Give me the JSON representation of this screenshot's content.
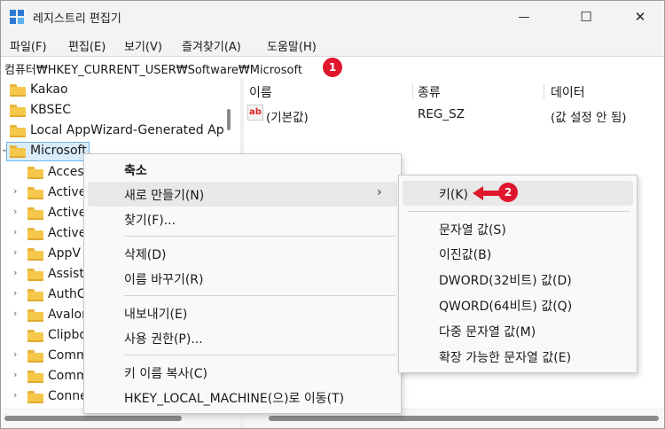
{
  "window": {
    "title": "레지스트리 편집기",
    "minimize_glyph": "—",
    "maximize_glyph": "☐",
    "close_glyph": "✕"
  },
  "menu": [
    "파일(F)",
    "편집(E)",
    "보기(V)",
    "즐겨찾기(A)",
    "도움말(H)"
  ],
  "address": {
    "path": "컴퓨터₩HKEY_CURRENT_USER₩Software₩Microsoft",
    "marker": "1"
  },
  "tree": {
    "items": [
      {
        "label": "Kakao"
      },
      {
        "label": "KBSEC"
      },
      {
        "label": "Local AppWizard-Generated Ap"
      },
      {
        "label": "Microsoft",
        "selected": true
      },
      {
        "label": "Acces"
      },
      {
        "label": "Active"
      },
      {
        "label": "Active"
      },
      {
        "label": "Active"
      },
      {
        "label": "AppV"
      },
      {
        "label": "Assist"
      },
      {
        "label": "AuthC"
      },
      {
        "label": "Avalon"
      },
      {
        "label": "Clipbo"
      },
      {
        "label": "Comm"
      },
      {
        "label": "Comm"
      },
      {
        "label": "Conne"
      }
    ]
  },
  "values": {
    "columns": [
      "이름",
      "종류",
      "데이터"
    ],
    "rows": [
      {
        "name": "(기본값)",
        "type": "REG_SZ",
        "data": "(값 설정 안 됨)",
        "icon": "ab"
      }
    ]
  },
  "context_menu": {
    "items": [
      {
        "label": "축소",
        "bold": true
      },
      {
        "label": "새로 만들기(N)",
        "submenu_arrow": "›",
        "highlighted": true
      },
      {
        "label": "찾기(F)..."
      },
      {
        "label": "삭제(D)"
      },
      {
        "label": "이름 바꾸기(R)"
      },
      {
        "label": "내보내기(E)"
      },
      {
        "label": "사용 권한(P)..."
      },
      {
        "label": "키 이름 복사(C)"
      },
      {
        "label": "HKEY_LOCAL_MACHINE(으)로 이동(T)"
      }
    ]
  },
  "submenu": {
    "items": [
      {
        "label": "키(K)",
        "highlighted": true
      },
      {
        "label": "문자열 값(S)"
      },
      {
        "label": "이진값(B)"
      },
      {
        "label": "DWORD(32비트) 값(D)"
      },
      {
        "label": "QWORD(64비트) 값(Q)"
      },
      {
        "label": "다중 문자열 값(M)"
      },
      {
        "label": "확장 가능한 문자열 값(E)"
      }
    ],
    "marker": "2"
  },
  "colors": {
    "marker": "#e0172c",
    "selection": "#d9ecfb"
  }
}
